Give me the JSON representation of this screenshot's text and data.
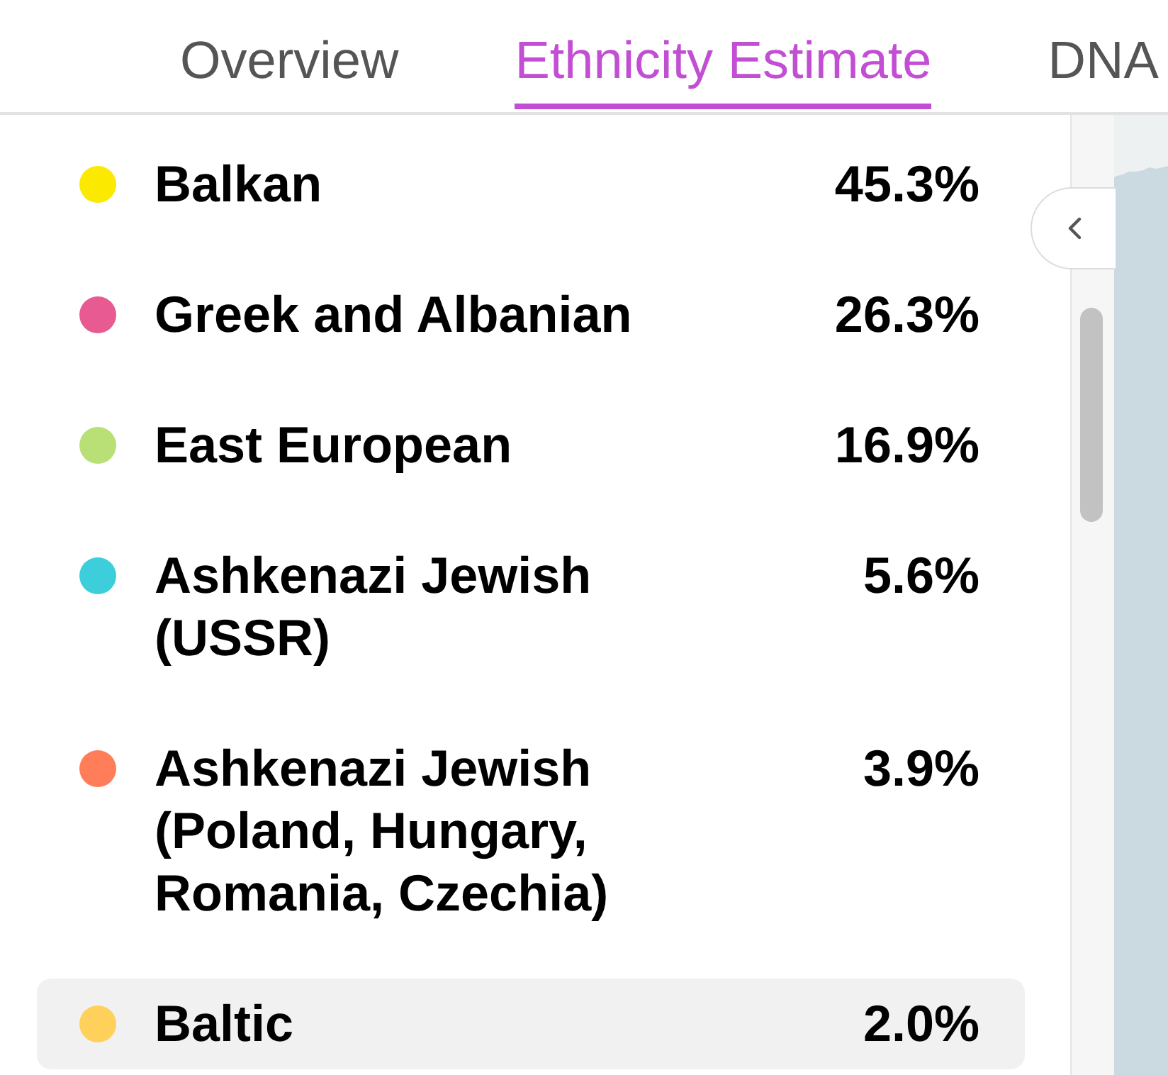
{
  "tabs": [
    {
      "label": "Overview",
      "selected": false
    },
    {
      "label": "Ethnicity Estimate",
      "selected": true
    },
    {
      "label": "DNA",
      "selected": false
    }
  ],
  "regions": [
    {
      "name": "Balkan",
      "percent": "45.3%",
      "color": "#fbe900",
      "selected": false
    },
    {
      "name": "Greek and Albanian",
      "percent": "26.3%",
      "color": "#e85a92",
      "selected": false
    },
    {
      "name": "East European",
      "percent": "16.9%",
      "color": "#b8e077",
      "selected": false
    },
    {
      "name": "Ashkenazi Jewish (USSR)",
      "percent": "5.6%",
      "color": "#3ccfdb",
      "selected": false
    },
    {
      "name": "Ashkenazi Jewish (Poland, Hungary, Romania, Czechia)",
      "percent": "3.9%",
      "color": "#ff7d59",
      "selected": false
    },
    {
      "name": "Baltic",
      "percent": "2.0%",
      "color": "#ffd05a",
      "selected": true
    }
  ]
}
